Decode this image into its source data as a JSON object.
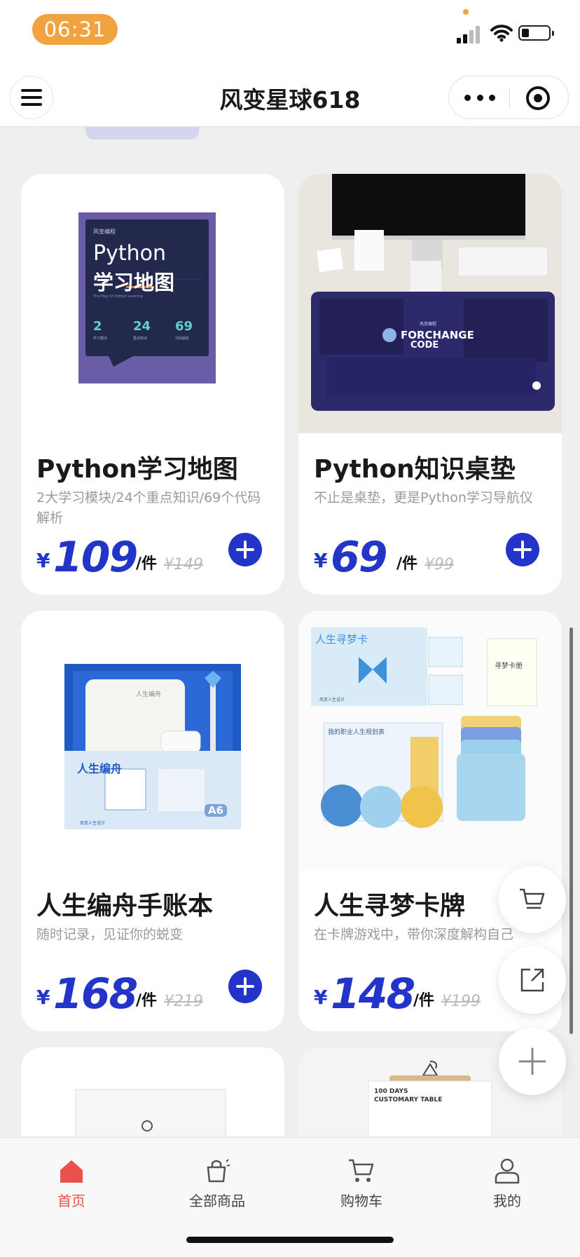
{
  "status_bar": {
    "time": "06:31"
  },
  "nav": {
    "title": "风变星球618"
  },
  "products": [
    {
      "title": "Python学习地图",
      "subtitle": "2大学习模块/24个重点知识/69个代码解析",
      "currency": "¥",
      "price": "109",
      "unit": "/件",
      "original_price": "¥149",
      "image_text": {
        "brand": "风变编程",
        "line1": "Python",
        "line2": "学习地图",
        "caption": "The Map Of Python Learning",
        "stat1": "2",
        "stat1_label": "学习模块",
        "stat2": "24",
        "stat2_label": "重点知识",
        "stat3": "69",
        "stat3_label": "代码解析"
      }
    },
    {
      "title": "Python知识桌垫",
      "subtitle": "不止是桌垫，更是Python学习导航仪",
      "currency": "¥",
      "price": "69",
      "unit": "/件",
      "original_price": "¥99",
      "image_text": {
        "brand": "风变编程",
        "logo_line1": "FORCHANGE",
        "logo_line2": "CODE"
      }
    },
    {
      "title": "人生编舟手账本",
      "subtitle": "随时记录，见证你的蜕变",
      "currency": "¥",
      "price": "168",
      "unit": "/件",
      "original_price": "¥219",
      "image_text": {
        "cover": "人生编舟",
        "notebook": "人生编舟",
        "size": "A6",
        "brand": "风变人生设计"
      }
    },
    {
      "title": "人生寻梦卡牌",
      "subtitle": "在卡牌游戏中，带你深度解构自己",
      "currency": "¥",
      "price": "148",
      "unit": "/件",
      "original_price": "¥199",
      "image_text": {
        "box": "人生寻梦卡",
        "card": "寻梦卡册",
        "book": "我的职业人生规划表",
        "brand": "风变人生设计"
      }
    },
    {
      "image_text": {}
    },
    {
      "image_text": {
        "line1": "100 DAYS",
        "line2": "CUSTOMARY TABLE"
      }
    }
  ],
  "tabs": [
    {
      "label": "首页",
      "icon": "home-icon",
      "active": true
    },
    {
      "label": "全部商品",
      "icon": "shopping-bag-icon",
      "active": false
    },
    {
      "label": "购物车",
      "icon": "cart-icon",
      "active": false
    },
    {
      "label": "我的",
      "icon": "user-icon",
      "active": false
    }
  ],
  "floating_buttons": [
    "cart-icon",
    "share-icon",
    "plus-icon"
  ],
  "colors": {
    "accent": "#2235c8",
    "active_tab": "#e9514a",
    "time_pill": "#f1a340"
  }
}
